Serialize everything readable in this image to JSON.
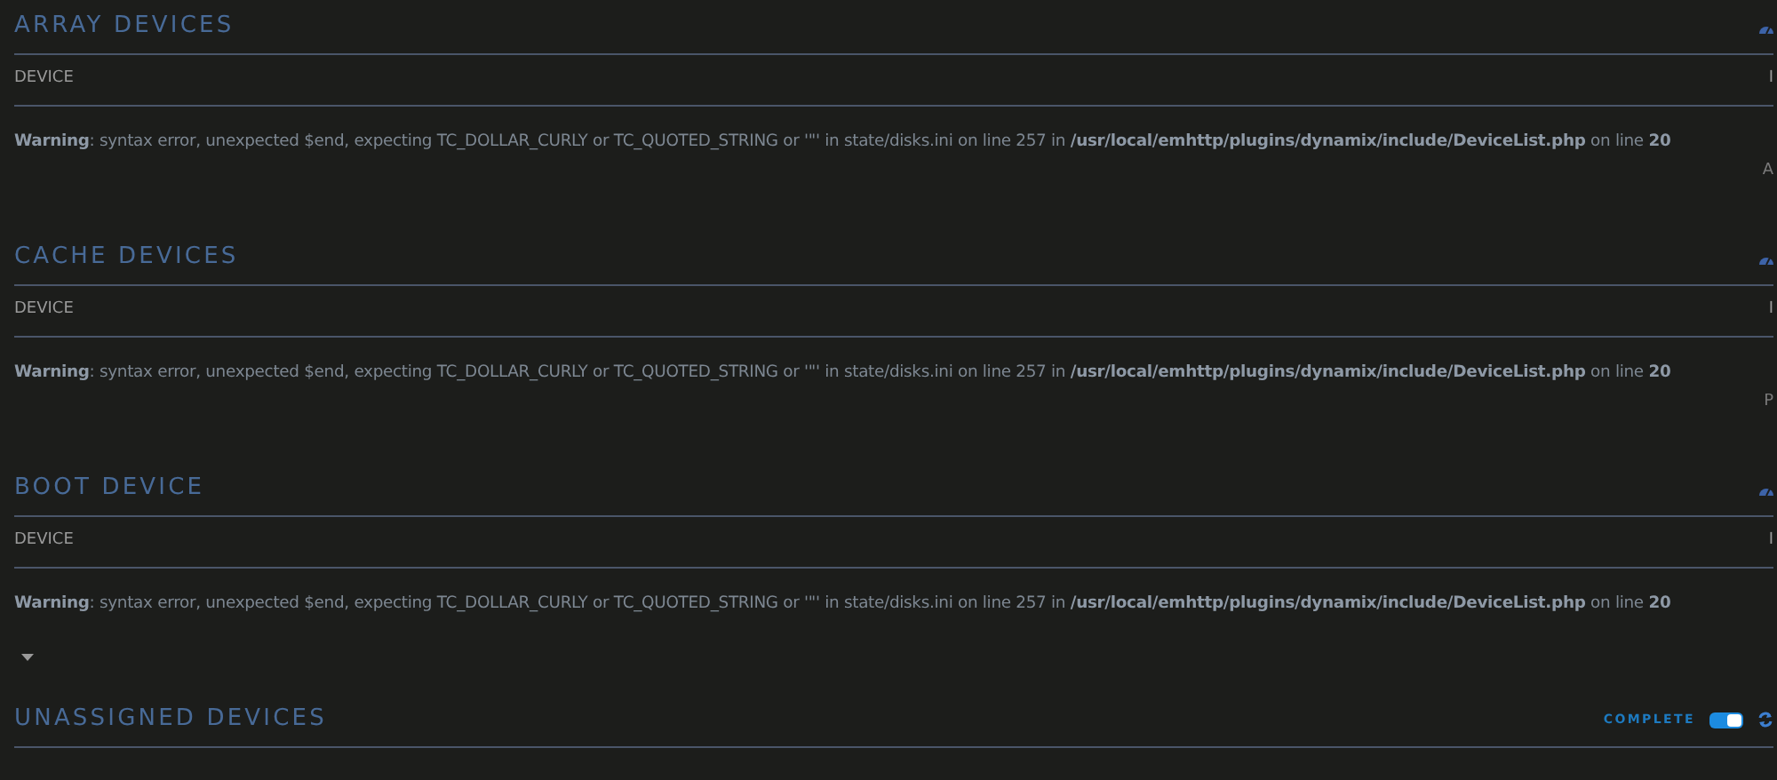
{
  "sections": [
    {
      "title": "ARRAY DEVICES",
      "kind": "table",
      "columns": [
        "DEVICE",
        "I"
      ],
      "warning": "**Warning**: syntax error, unexpected $end, expecting TC_DOLLAR_CURLY or TC_QUOTED_STRING or '\"' in state/disks.ini on line 257 in **/usr/local/emhttp/plugins/dynamix/include/DeviceList.php** on line **20**",
      "side_text": "A",
      "caret": false
    },
    {
      "title": "CACHE DEVICES",
      "kind": "table",
      "columns": [
        "DEVICE",
        "I"
      ],
      "warning": "**Warning**: syntax error, unexpected $end, expecting TC_DOLLAR_CURLY or TC_QUOTED_STRING or '\"' in state/disks.ini on line 257 in **/usr/local/emhttp/plugins/dynamix/include/DeviceList.php** on line **20**",
      "side_text": "P",
      "caret": false
    },
    {
      "title": "BOOT DEVICE",
      "kind": "table",
      "columns": [
        "DEVICE",
        "I"
      ],
      "warning": "**Warning**: syntax error, unexpected $end, expecting TC_DOLLAR_CURLY or TC_QUOTED_STRING or '\"' in state/disks.ini on line 257 in **/usr/local/emhttp/plugins/dynamix/include/DeviceList.php** on line **20**",
      "caret": true
    },
    {
      "title": "UNASSIGNED DEVICES",
      "kind": "toggle",
      "toggle_label": "COMPLETE",
      "on": true
    }
  ]
}
